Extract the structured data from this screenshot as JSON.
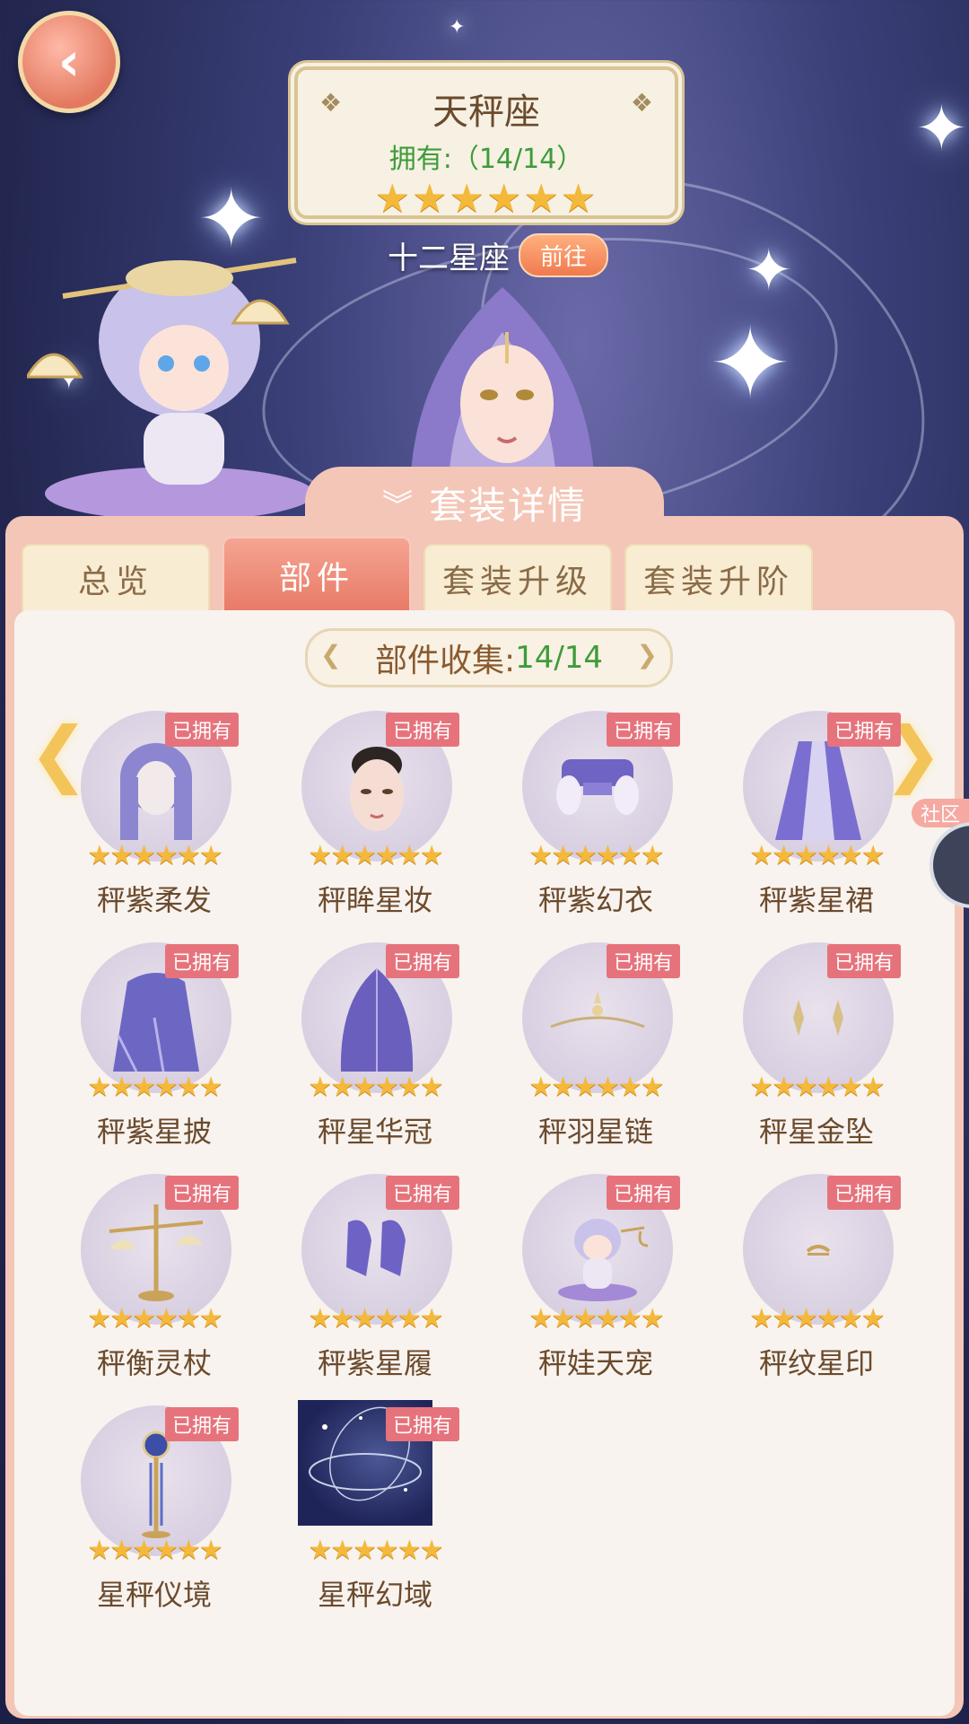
{
  "header": {
    "constellation_name": "天秤座",
    "owned_text": "拥有:（14/14）",
    "star_rating": 6,
    "collection_label": "十二星座",
    "goto_button": "前往"
  },
  "panel": {
    "title": "套装详情",
    "tabs": [
      {
        "label": "总览",
        "active": false
      },
      {
        "label": "部件",
        "active": true
      },
      {
        "label": "套装升级",
        "active": false
      },
      {
        "label": "套装升阶",
        "active": false
      }
    ],
    "count_label": "部件收集:",
    "count_value": "14/14"
  },
  "side": {
    "community_label": "社区"
  },
  "items": [
    {
      "name": "秤紫柔发",
      "badge": "已拥有",
      "stars": 6,
      "icon": "hair-icon"
    },
    {
      "name": "秤眸星妆",
      "badge": "已拥有",
      "stars": 6,
      "icon": "makeup-icon"
    },
    {
      "name": "秤紫幻衣",
      "badge": "已拥有",
      "stars": 6,
      "icon": "top-icon"
    },
    {
      "name": "秤紫星裙",
      "badge": "已拥有",
      "stars": 6,
      "icon": "skirt-icon"
    },
    {
      "name": "秤紫星披",
      "badge": "已拥有",
      "stars": 6,
      "icon": "cape-icon"
    },
    {
      "name": "秤星华冠",
      "badge": "已拥有",
      "stars": 6,
      "icon": "veil-icon"
    },
    {
      "name": "秤羽星链",
      "badge": "已拥有",
      "stars": 6,
      "icon": "chain-icon"
    },
    {
      "name": "秤星金坠",
      "badge": "已拥有",
      "stars": 6,
      "icon": "earring-icon"
    },
    {
      "name": "秤衡灵杖",
      "badge": "已拥有",
      "stars": 6,
      "icon": "scale-staff-icon"
    },
    {
      "name": "秤紫星履",
      "badge": "已拥有",
      "stars": 6,
      "icon": "shoes-icon"
    },
    {
      "name": "秤娃天宠",
      "badge": "已拥有",
      "stars": 6,
      "icon": "pet-doll-icon"
    },
    {
      "name": "秤纹星印",
      "badge": "已拥有",
      "stars": 6,
      "icon": "mark-icon"
    },
    {
      "name": "星秤仪境",
      "badge": "已拥有",
      "stars": 6,
      "icon": "scepter-icon"
    },
    {
      "name": "星秤幻域",
      "badge": "已拥有",
      "stars": 6,
      "icon": "background-icon"
    }
  ]
}
